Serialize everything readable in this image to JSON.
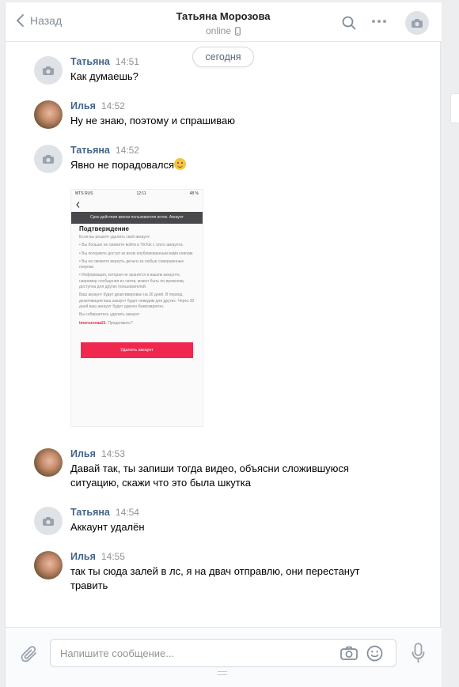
{
  "header": {
    "back_label": "Назад",
    "title": "Татьяна Морозова",
    "status": "online"
  },
  "date_divider": "сегодня",
  "messages": [
    {
      "author": "Татьяна",
      "time": "14:51",
      "text": "Как думаешь?"
    },
    {
      "author": "Илья",
      "time": "14:52",
      "text": "Ну не знаю, поэтому и спрашиваю"
    },
    {
      "author": "Татьяна",
      "time": "14:52",
      "text": "Явно не порадовался"
    },
    {
      "author": "Илья",
      "time": "14:53",
      "text": "Давай так, ты запиши тогда видео, объясни сложившуюся ситуацию, скажи что это была шкутка"
    },
    {
      "author": "Татьяна",
      "time": "14:54",
      "text": "Аккаунт удалён"
    },
    {
      "author": "Илья",
      "time": "14:55",
      "text": "так ты сюда залей в лс, я на двач отправлю, они перестанут травить"
    }
  ],
  "attachment": {
    "status_left": "MTS RUS",
    "status_time": "12:11",
    "status_right": "48 %",
    "banner": "Срок действия имени пользователя истек. Аккаунт",
    "heading": "Подтверждение",
    "intro": "Если вы решите удалить свой аккаунт:",
    "bullets": [
      "• Вы больше не сможете войти в TikTok с этого аккаунта.",
      "• Вы потеряете доступ ко всем опубликованным вами клипам.",
      "• Вы не сможете вернуть деньги за любые совершенные покупки.",
      "• Информация, которая не хранится в вашем аккаунте, например сообщения из чатов, может быть по-прежнему доступна для других пользователей."
    ],
    "deactivation_note": "Ваш аккаунт будет деактивирован на 30 дней. В период деактивации ваш аккаунт будет невидим для других. Через 30 дней ваш аккаунт будет удален безвозвратно.",
    "question_prefix": "Вы собираетесь удалить аккаунт",
    "username": "tmorozovaa21",
    "question_suffix": ". Продолжить?",
    "button": "Удалить аккаунт"
  },
  "composer": {
    "placeholder": "Напишите сообщение..."
  }
}
